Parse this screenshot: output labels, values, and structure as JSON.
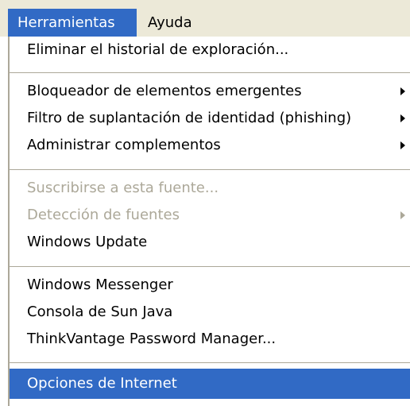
{
  "menubar": {
    "items": [
      {
        "label": "Herramientas"
      },
      {
        "label": "Ayuda"
      }
    ]
  },
  "menu": {
    "items": [
      {
        "label": "Eliminar el historial de exploración..."
      },
      {
        "label": "Bloqueador de elementos emergentes"
      },
      {
        "label": "Filtro de suplantación de identidad (phishing)"
      },
      {
        "label": "Administrar complementos"
      },
      {
        "label": "Suscribirse a esta fuente..."
      },
      {
        "label": "Detección de fuentes"
      },
      {
        "label": "Windows Update"
      },
      {
        "label": "Windows Messenger"
      },
      {
        "label": "Consola de Sun Java"
      },
      {
        "label": "ThinkVantage Password Manager..."
      },
      {
        "label": "Opciones de Internet"
      }
    ]
  }
}
